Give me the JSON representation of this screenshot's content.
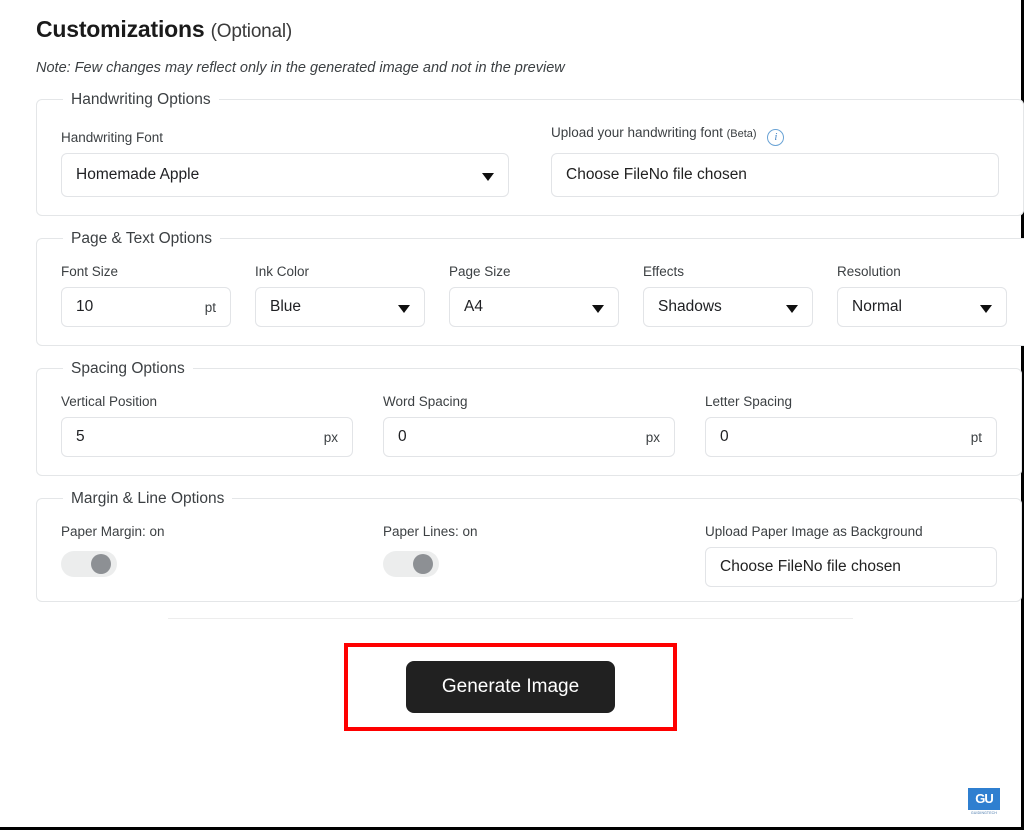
{
  "header": {
    "title": "Customizations",
    "optional": "(Optional)",
    "note": "Note: Few changes may reflect only in the generated image and not in the preview"
  },
  "sections": {
    "handwriting": {
      "legend": "Handwriting Options",
      "font_label": "Handwriting Font",
      "font_value": "Homemade Apple",
      "upload_label": "Upload your handwriting font",
      "upload_beta": "(Beta)",
      "info_icon": "info-icon",
      "upload_value": "Choose FileNo file chosen"
    },
    "page_text": {
      "legend": "Page & Text Options",
      "font_size_label": "Font Size",
      "font_size_value": "10",
      "font_size_unit": "pt",
      "ink_color_label": "Ink Color",
      "ink_color_value": "Blue",
      "page_size_label": "Page Size",
      "page_size_value": "A4",
      "effects_label": "Effects",
      "effects_value": "Shadows",
      "resolution_label": "Resolution",
      "resolution_value": "Normal"
    },
    "spacing": {
      "legend": "Spacing Options",
      "vertical_label": "Vertical Position",
      "vertical_value": "5",
      "vertical_unit": "px",
      "word_label": "Word Spacing",
      "word_value": "0",
      "word_unit": "px",
      "letter_label": "Letter Spacing",
      "letter_value": "0",
      "letter_unit": "pt"
    },
    "margin_line": {
      "legend": "Margin & Line Options",
      "paper_margin_label": "Paper Margin: on",
      "paper_lines_label": "Paper Lines: on",
      "bg_label": "Upload Paper Image as Background",
      "bg_value": "Choose FileNo file chosen"
    }
  },
  "footer": {
    "generate_label": "Generate Image",
    "highlight_color": "#fe0000",
    "button_color": "#212121"
  },
  "watermark": {
    "mark_text": "GU",
    "caption": "GUIDINGTECH"
  }
}
